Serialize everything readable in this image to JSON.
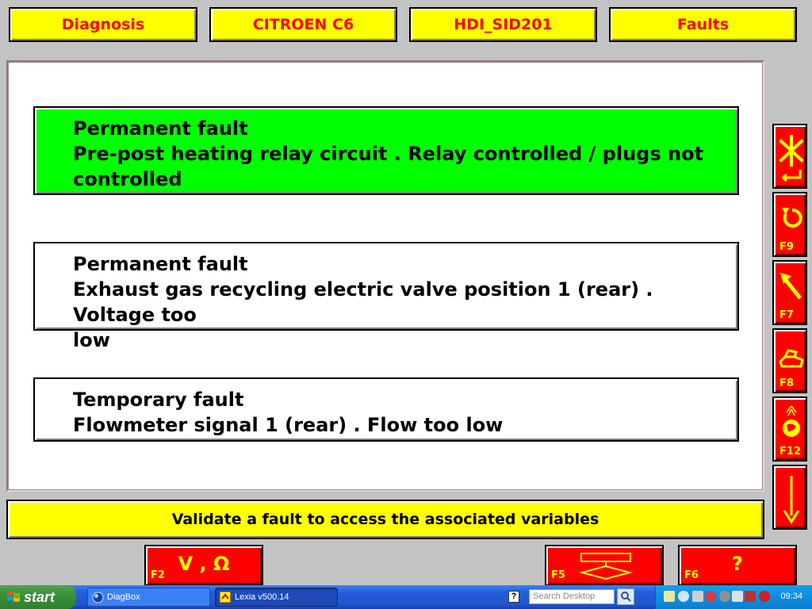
{
  "header": {
    "diagnosis": "Diagnosis",
    "vehicle": "CITROEN C6",
    "ecu": "HDI_SID201",
    "section": "Faults"
  },
  "faults": [
    {
      "type": "Permanent fault",
      "line1": "Pre-post heating relay circuit . Relay controlled / plugs not",
      "line2": "controlled",
      "selected": true
    },
    {
      "type": "Permanent fault",
      "line1": "Exhaust gas recycling electric valve position 1 (rear) . Voltage too",
      "line2": "low",
      "selected": false
    },
    {
      "type": "Temporary fault",
      "line1": "Flowmeter signal 1 (rear) . Flow too low",
      "line2": "",
      "selected": false
    }
  ],
  "side_toolbar": {
    "validate_fkey": "",
    "refresh_fkey": "F9",
    "back_fkey": "F7",
    "print_fkey": "F8",
    "globe_fkey": "F12",
    "down_fkey": ""
  },
  "status_message": "Validate a fault to access the associated variables",
  "bottom_buttons": {
    "measure_fkey": "F2",
    "measure_label": "V , Ω",
    "flow_fkey": "F5",
    "help_fkey": "F6",
    "help_label": "?"
  },
  "taskbar": {
    "start_label": "start",
    "tasks": [
      "DiagBox",
      "Lexia v500.14"
    ],
    "search_placeholder": "Search Desktop",
    "clock": "09:34",
    "help_icon": "?"
  },
  "colors": {
    "header_bg": "#ffff00",
    "header_text": "#ff0000",
    "selected_fault": "#00ff00",
    "tool_button": "#ff0000",
    "tool_glyph": "#ffff00"
  }
}
